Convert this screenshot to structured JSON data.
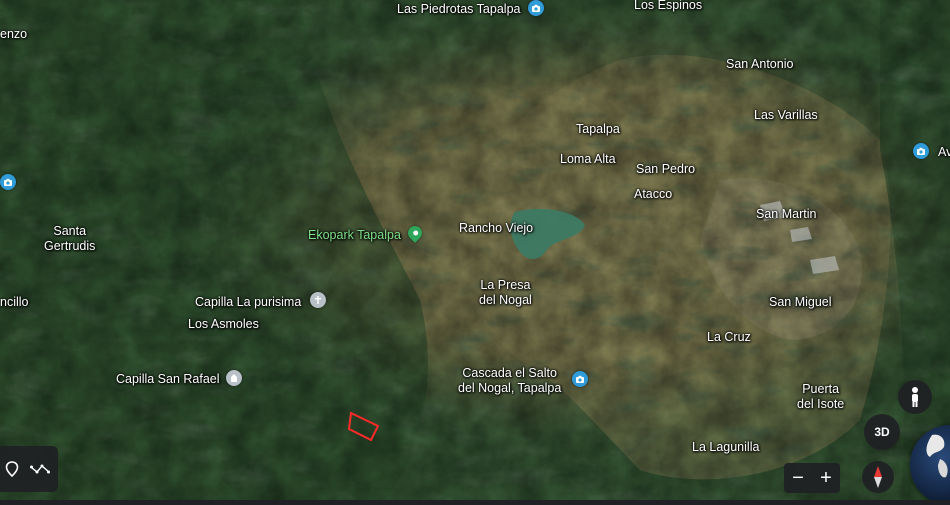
{
  "colors": {
    "accent_blue": "#2f9bd8",
    "park_green": "#2fa55a",
    "polygon_red": "#ff2a2a"
  },
  "labels": {
    "las_piedrotas": "Las Piedrotas Tapalpa",
    "los_espinos": "Los Espinos",
    "enzo": "enzo",
    "san_antonio": "San Antonio",
    "las_varillas": "Las Varillas",
    "tapalpa": "Tapalpa",
    "loma_alta": "Loma Alta",
    "san_pedro": "San Pedro",
    "av": "Av",
    "atacco": "Atacco",
    "santa_gertrudis": "Santa\nGertrudis",
    "ekopark": "Ekopark Tapalpa",
    "rancho_viejo": "Rancho Viejo",
    "san_martin": "San Martin",
    "la_presa": "La Presa\ndel Nogal",
    "ncillo": "ncillo",
    "capilla_purisima": "Capilla La purisima",
    "san_miguel": "San Miguel",
    "los_asmoles": "Los Asmoles",
    "la_cruz": "La Cruz",
    "capilla_san_rafael": "Capilla San Rafael",
    "cascada": "Cascada el Salto\ndel Nogal, Tapalpa",
    "puerta_isote": "Puerta\ndel Isote",
    "la_lagunilla": "La Lagunilla"
  },
  "controls": {
    "btn_3d": "3D",
    "zoom_out": "−",
    "zoom_in": "+"
  },
  "icons": {
    "camera": "camera-icon",
    "cross": "church-icon",
    "location": "location-pin-icon",
    "pegman": "pegman-icon",
    "compass": "compass-icon",
    "ruler": "measure-icon",
    "globe": "globe-icon"
  }
}
